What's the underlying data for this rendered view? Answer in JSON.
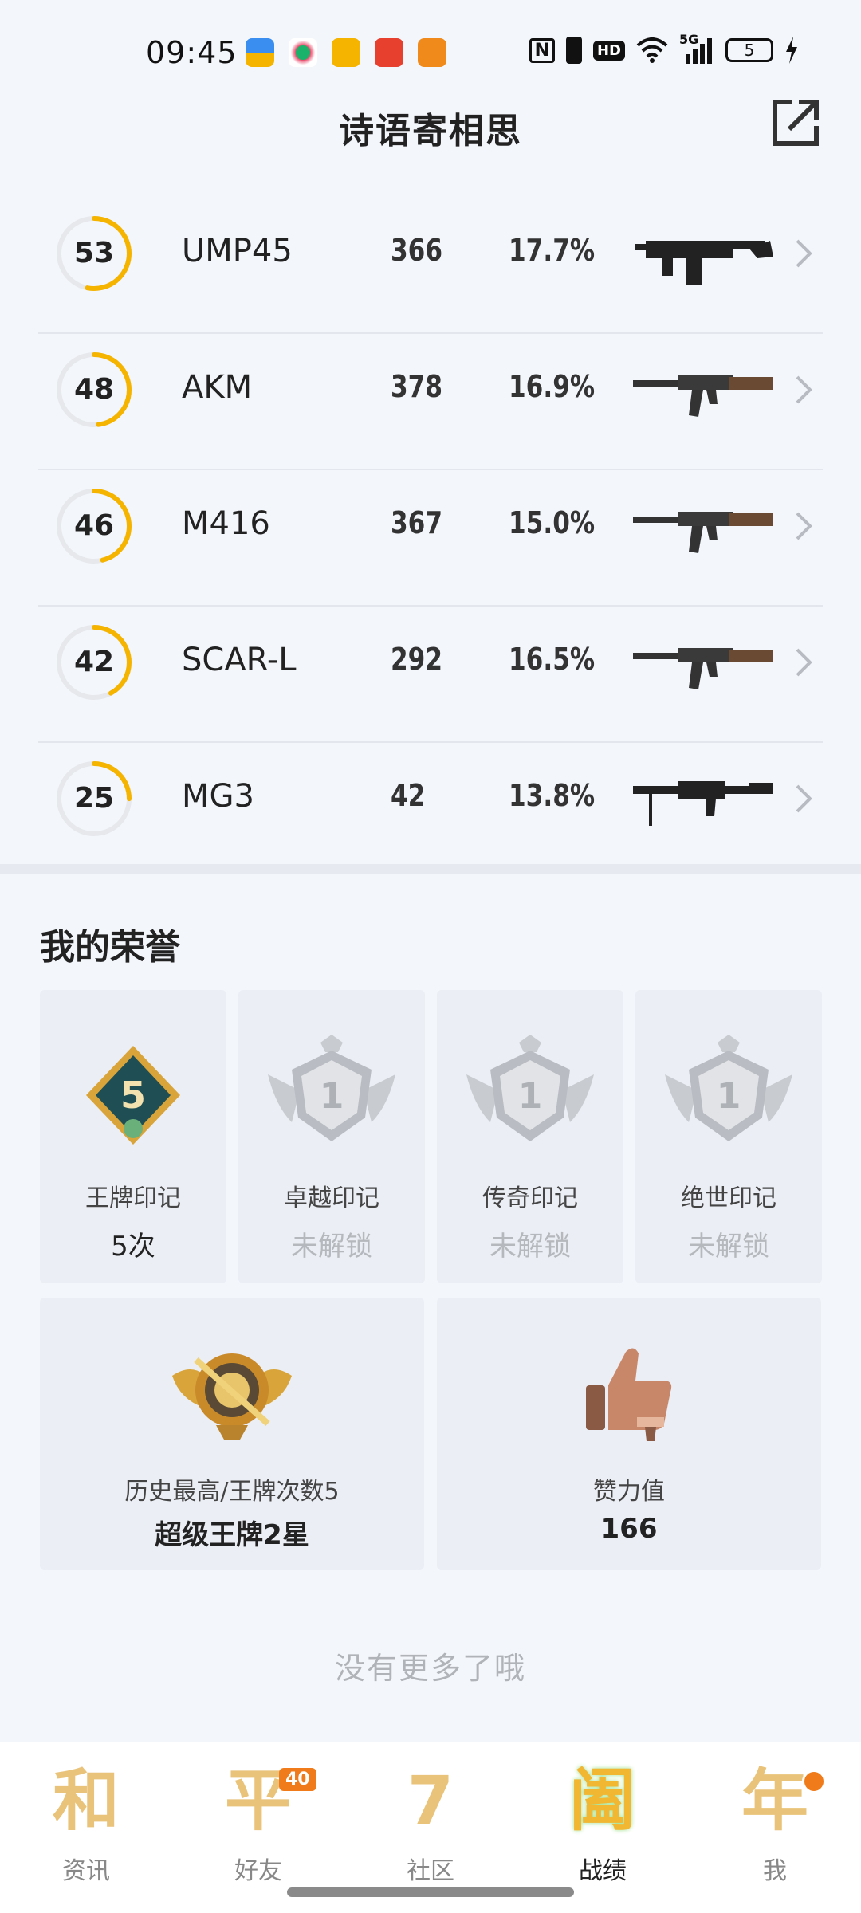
{
  "status": {
    "time": "09:45",
    "nfc": "N",
    "hd": "HD",
    "net": "5G",
    "battery": "5"
  },
  "header": {
    "title": "诗语寄相思"
  },
  "weapons": [
    {
      "score": "53",
      "name": "UMP45",
      "count": "366",
      "pct": "17.7%",
      "progress": 0.53,
      "icon": "smg-icon"
    },
    {
      "score": "48",
      "name": "AKM",
      "count": "378",
      "pct": "16.9%",
      "progress": 0.48,
      "icon": "rifle-icon"
    },
    {
      "score": "46",
      "name": "M416",
      "count": "367",
      "pct": "15.0%",
      "progress": 0.46,
      "icon": "rifle-icon"
    },
    {
      "score": "42",
      "name": "SCAR-L",
      "count": "292",
      "pct": "16.5%",
      "progress": 0.42,
      "icon": "rifle-icon"
    },
    {
      "score": "25",
      "name": "MG3",
      "count": "42",
      "pct": "13.8%",
      "progress": 0.25,
      "icon": "lmg-icon"
    }
  ],
  "honor": {
    "title": "我的荣誉",
    "marks": [
      {
        "label": "王牌印记",
        "value": "5次",
        "badge": "5",
        "locked": false
      },
      {
        "label": "卓越印记",
        "value": "未解锁",
        "badge": "1",
        "locked": true
      },
      {
        "label": "传奇印记",
        "value": "未解锁",
        "badge": "1",
        "locked": true
      },
      {
        "label": "绝世印记",
        "value": "未解锁",
        "badge": "1",
        "locked": true
      }
    ],
    "history": {
      "label": "历史最高/王牌次数5",
      "value": "超级王牌2星"
    },
    "likes": {
      "label": "赞力值",
      "value": "166"
    }
  },
  "footer_text": "没有更多了哦",
  "nav": [
    {
      "glyph": "和",
      "label": "资讯"
    },
    {
      "glyph": "平",
      "label": "好友",
      "badge": "40"
    },
    {
      "glyph": "7",
      "label": "社区"
    },
    {
      "glyph": "阖",
      "label": "战绩"
    },
    {
      "glyph": "年",
      "label": "我"
    }
  ],
  "colors": {
    "accent": "#f5b400",
    "ring_track": "#e6e8ec",
    "nav_gold": "#e9c37a",
    "badge_orange": "#f07b1a"
  }
}
